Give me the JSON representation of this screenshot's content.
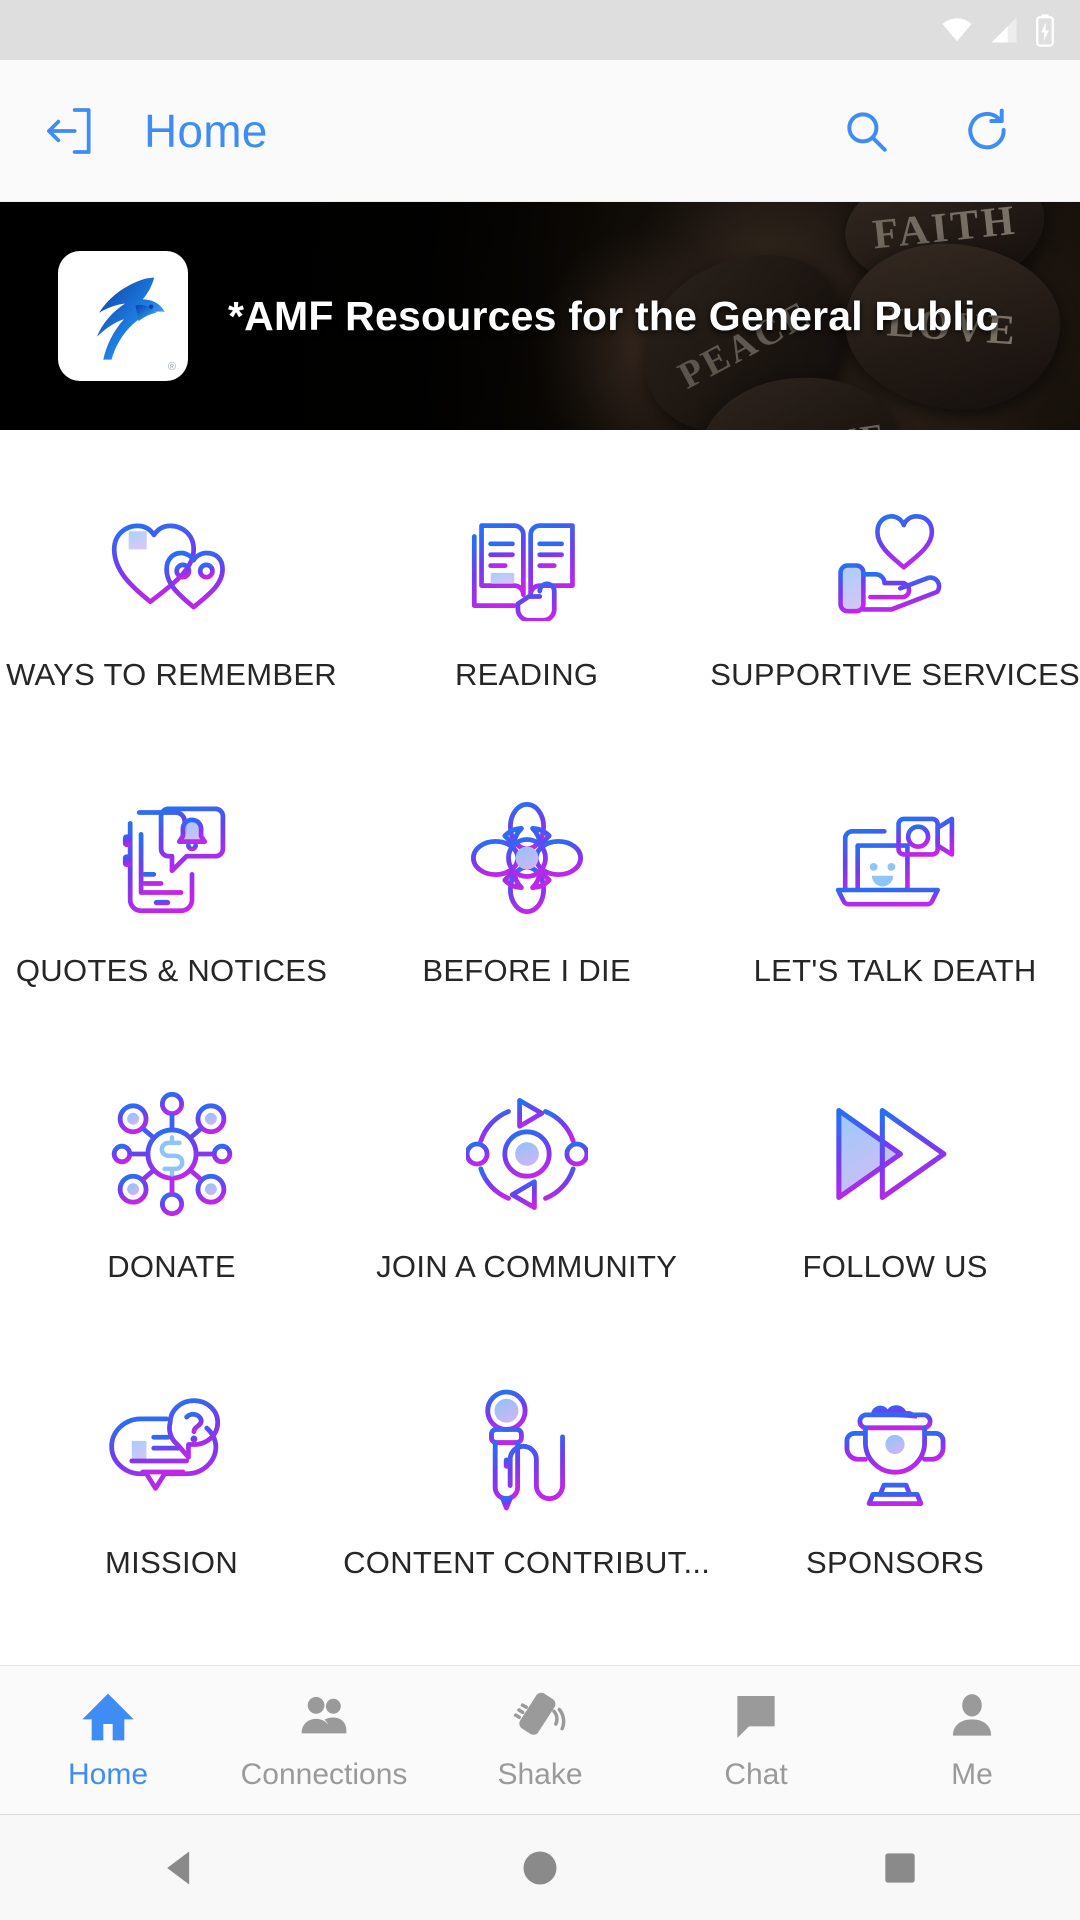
{
  "status_bar": {
    "icons": [
      "wifi-icon",
      "cellular-signal-icon",
      "battery-charging-icon"
    ]
  },
  "toolbar": {
    "back_icon": "exit-left-icon",
    "title": "Home",
    "search_icon": "search-icon",
    "refresh_icon": "refresh-icon",
    "accent_color": "#3f8cf4"
  },
  "banner": {
    "title": "*AMF Resources for the General Public",
    "logo_icon": "amf-bird-logo",
    "registered_mark": "®",
    "photo_words": [
      "FAITH",
      "PEACE",
      "LOVE",
      "BELIEVE"
    ]
  },
  "grid": {
    "gradient_start": "#2a6df4",
    "gradient_end": "#c425e8",
    "items": [
      {
        "label": "WAYS TO REMEMBER",
        "icon": "two-hearts-icon"
      },
      {
        "label": "READING",
        "icon": "open-book-hand-icon"
      },
      {
        "label": "SUPPORTIVE SERVICES",
        "icon": "hand-heart-icon"
      },
      {
        "label": "QUOTES & NOTICES",
        "icon": "phone-notification-bell-icon"
      },
      {
        "label": "BEFORE I DIE",
        "icon": "flower-icon"
      },
      {
        "label": "LET'S TALK DEATH",
        "icon": "laptop-video-call-icon"
      },
      {
        "label": "DONATE",
        "icon": "dollar-network-icon"
      },
      {
        "label": "JOIN A COMMUNITY",
        "icon": "orbit-arrows-icon"
      },
      {
        "label": "FOLLOW US",
        "icon": "double-play-icon"
      },
      {
        "label": "MISSION",
        "icon": "speech-bubble-question-icon"
      },
      {
        "label": "CONTENT CONTRIBUT...",
        "icon": "microphone-icon"
      },
      {
        "label": "SPONSORS",
        "icon": "trophy-icon"
      }
    ]
  },
  "bottom_nav": {
    "active_index": 0,
    "active_color": "#3f8cf4",
    "inactive_color": "#9a9a9a",
    "items": [
      {
        "label": "Home",
        "icon": "home-icon"
      },
      {
        "label": "Connections",
        "icon": "people-icon"
      },
      {
        "label": "Shake",
        "icon": "shake-phone-icon"
      },
      {
        "label": "Chat",
        "icon": "chat-bubble-icon"
      },
      {
        "label": "Me",
        "icon": "person-icon"
      }
    ]
  },
  "system_nav": {
    "items": [
      {
        "icon": "android-back-icon"
      },
      {
        "icon": "android-home-icon"
      },
      {
        "icon": "android-recents-icon"
      }
    ]
  }
}
